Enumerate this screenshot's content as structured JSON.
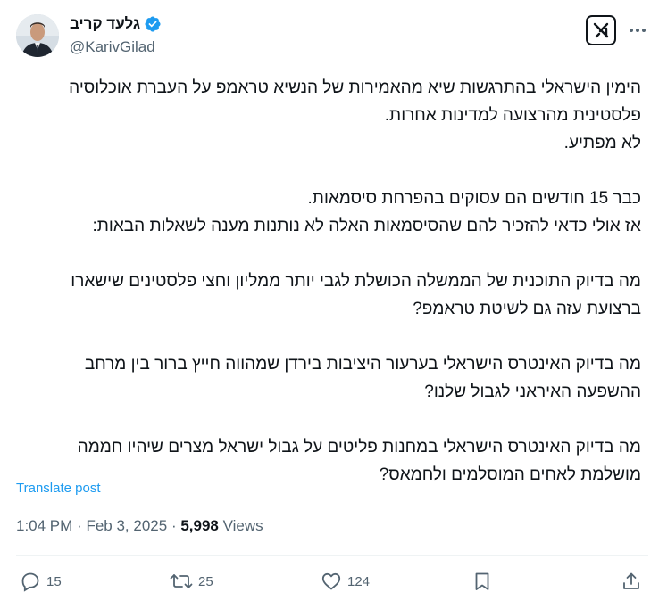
{
  "author": {
    "display_name": "גלעד קריב",
    "handle": "@KarivGilad"
  },
  "icons": {
    "verified": "verified-badge-icon",
    "grok": "grok-icon",
    "more": "more-icon"
  },
  "colors": {
    "accent": "#1d9bf0",
    "text": "#0f1419",
    "muted": "#536471"
  },
  "tweet": {
    "text": "הימין הישראלי בהתרגשות שיא מהאמירות של הנשיא טראמפ על העברת אוכלוסיה פלסטינית מהרצועה למדינות אחרות.\nלא מפתיע.\n\nכבר 15 חודשים הם עסוקים בהפרחת סיסמאות.\nאז אולי כדאי להזכיר להם שהסיסמאות האלה לא נותנות מענה לשאלות הבאות:\n\nמה בדיוק התוכנית של הממשלה הכושלת לגבי יותר ממליון וחצי פלסטינים שישארו ברצועת עזה גם לשיטת טראמפ?\n\nמה בדיוק האינטרס הישראלי בערעור היציבות בירדן שמהווה חייץ ברור בין מרחב ההשפעה האיראני לגבול שלנו?\n\nמה בדיוק האינטרס הישראלי במחנות פליטים על גבול ישראל מצרים שיהיו חממה מושלמת לאחים המוסלמים ולחמאס?",
    "translate_label": "Translate post"
  },
  "meta": {
    "time": "1:04 PM",
    "separator": "·",
    "date": "Feb 3, 2025",
    "views_count": "5,998",
    "views_label": "Views"
  },
  "actions": {
    "replies": "15",
    "reposts": "25",
    "likes": "124"
  }
}
